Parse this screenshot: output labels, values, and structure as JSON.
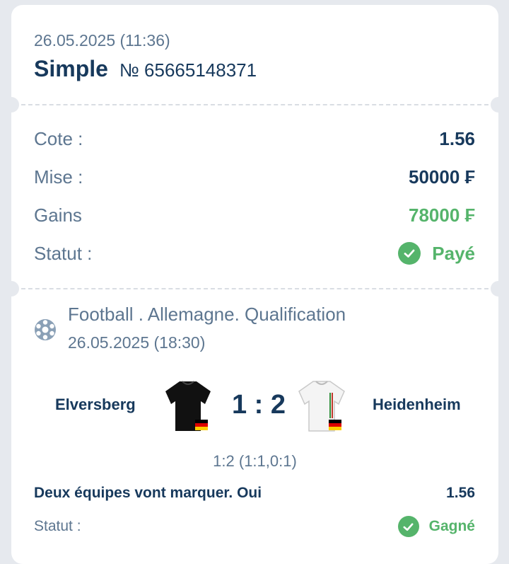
{
  "ticket": {
    "date": "26.05.2025 (11:36)",
    "type": "Simple",
    "number": "№ 65665148371"
  },
  "summary": {
    "odds_label": "Cote :",
    "odds_value": "1.56",
    "stake_label": "Mise :",
    "stake_value": "50000 ₣",
    "winnings_label": "Gains",
    "winnings_value": "78000 ₣",
    "status_label": "Statut :",
    "status_value": "Payé",
    "status_icon": "check-circle-icon"
  },
  "event": {
    "sport_icon": "soccer-ball-icon",
    "title": "Football . Allemagne. Qualification",
    "date": "26.05.2025 (18:30)",
    "home_team": "Elversberg",
    "away_team": "Heidenheim",
    "score": "1 : 2",
    "score_detail": "1:2 (1:1,0:1)",
    "home_jersey_color": "#111111",
    "away_jersey_color": "#f4f4f4",
    "flag": "germany-flag-icon"
  },
  "selection": {
    "label": "Deux équipes vont marquer. Oui",
    "odds": "1.56",
    "status_label": "Statut :",
    "status_value": "Gagné",
    "status_icon": "check-circle-icon"
  },
  "colors": {
    "primary": "#17395c",
    "muted": "#5d7690",
    "success": "#55b46b",
    "background": "#e6e9ee"
  }
}
